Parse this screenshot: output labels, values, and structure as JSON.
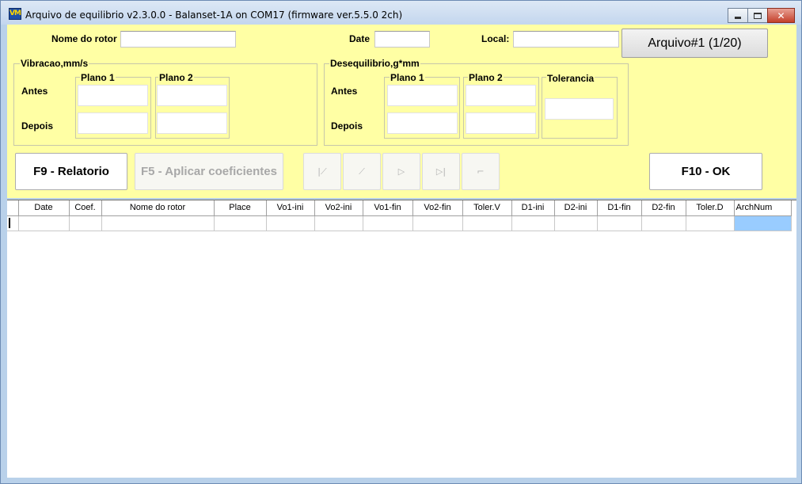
{
  "window": {
    "icon": "vm-logo-icon",
    "icon_text": "VM",
    "title": "Arquivo de equilibrio v2.3.0.0 - Balanset-1A on COM17 (firmware ver.5.5.0 2ch)"
  },
  "header": {
    "rotor_label": "Nome do rotor",
    "rotor_value": "",
    "date_label": "Date",
    "date_value": "",
    "local_label": "Local:",
    "local_value": "",
    "archive_button": "Arquivo#1 (1/20)"
  },
  "vibration": {
    "group_label": "Vibracao,mm/s",
    "plane1": "Plano 1",
    "plane2": "Plano 2",
    "before": "Antes",
    "after": "Depois"
  },
  "imbalance": {
    "group_label": "Desequilibrio,g*mm",
    "plane1": "Plano 1",
    "plane2": "Plano 2",
    "tolerance": "Tolerancia",
    "before": "Antes",
    "after": "Depois"
  },
  "buttons": {
    "report": "F9 - Relatorio",
    "apply_coef": "F5 - Aplicar coeficientes",
    "ok": "F10 - OK"
  },
  "nav_icons": [
    "first-record-icon",
    "prev-record-icon",
    "next-record-icon",
    "last-record-icon",
    "delete-record-icon"
  ],
  "nav_glyphs": [
    "|⟋",
    "⟋",
    "▷",
    "▷|",
    "⌐"
  ],
  "table": {
    "columns": [
      "Date",
      "Coef.",
      "Nome do rotor",
      "Place",
      "Vo1-ini",
      "Vo2-ini",
      "Vo1-fin",
      "Vo2-fin",
      "Toler.V",
      "D1-ini",
      "D2-ini",
      "D1-fin",
      "D2-fin",
      "Toler.D",
      "ArchNum"
    ]
  },
  "colors": {
    "panel_background": "#ffffa4",
    "window_border": "#b9d1ea",
    "selected_cell": "#99ccff",
    "close_button": "#c4402b"
  }
}
